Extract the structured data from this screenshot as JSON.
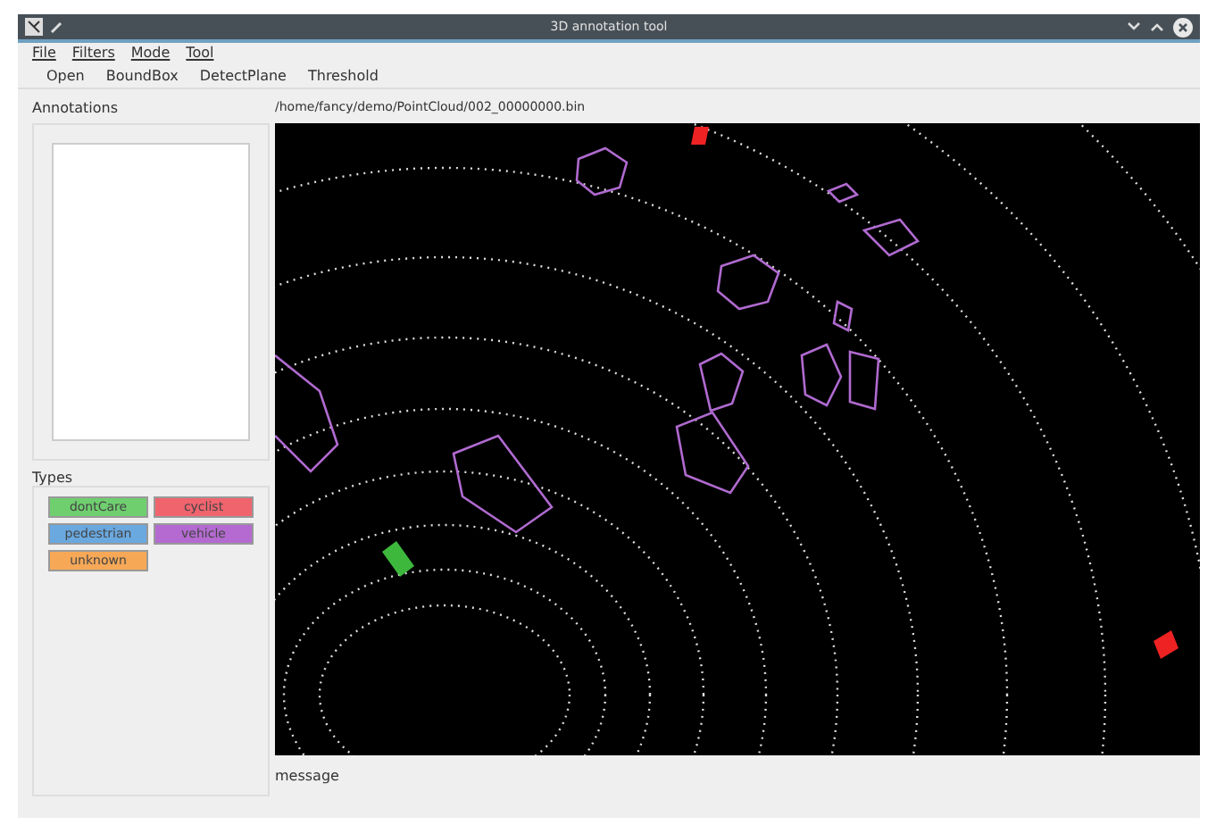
{
  "window": {
    "title": "3D annotation tool"
  },
  "menu": [
    "File",
    "Filters",
    "Mode",
    "Tool"
  ],
  "toolbar": [
    "Open",
    "BoundBox",
    "DetectPlane",
    "Threshold"
  ],
  "annotations": {
    "title": "Annotations"
  },
  "types": {
    "title": "Types",
    "items": [
      {
        "label": "dontCare",
        "color": "#6fcf6f"
      },
      {
        "label": "cyclist",
        "color": "#f0646e"
      },
      {
        "label": "pedestrian",
        "color": "#6aa8e0"
      },
      {
        "label": "vehicle",
        "color": "#b46ad0"
      },
      {
        "label": "unknown",
        "color": "#f6a857"
      }
    ]
  },
  "viewer": {
    "path": "/home/fancy/demo/PointCloud/002_00000000.bin"
  },
  "status": "message"
}
